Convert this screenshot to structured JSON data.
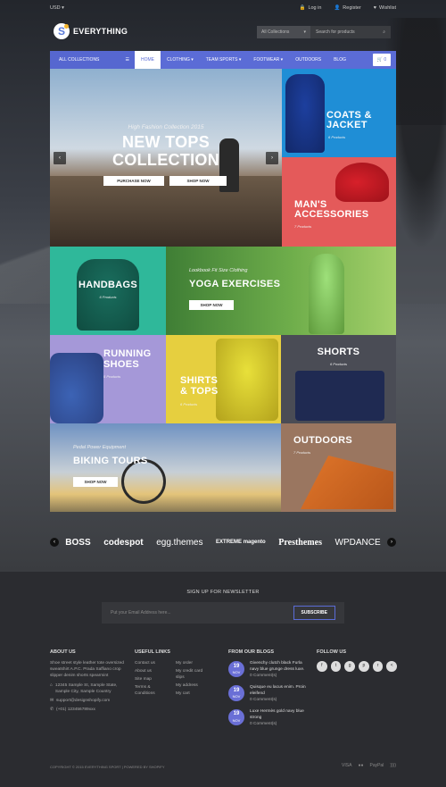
{
  "topbar": {
    "currency": "USD ▾",
    "login": "Log in",
    "register": "Register",
    "wishlist": "Wishlist"
  },
  "brand": {
    "name": "EVERYTHING",
    "mark": "S"
  },
  "search": {
    "category": "All Collections",
    "placeholder": "Search for products"
  },
  "nav": {
    "all": "ALL COLLECTIONS",
    "items": [
      "HOME",
      "CLOTHING ▾",
      "TEAM SPORTS ▾",
      "FOOTWEAR ▾",
      "OUTDOORS",
      "BLOG"
    ],
    "cart": "0"
  },
  "slider": {
    "kicker": "High Fashion Collection 2015",
    "title1": "NEW TOPS",
    "title2": "COLLECTION",
    "btn1": "PURCHASE NOW",
    "btn2": "SHOP NOW"
  },
  "tiles": {
    "coats": {
      "t1": "COATS &",
      "t2": "JACKET",
      "sub": "6 Products"
    },
    "mans": {
      "t1": "MAN'S",
      "t2": "ACCESSORIES",
      "sub": "7 Products"
    },
    "handbags": {
      "t1": "HANDBAGS",
      "sub": "6 Products"
    },
    "yoga": {
      "kicker": "Lookbook Fit Size Clothing",
      "t1": "YOGA EXERCISES",
      "btn": "SHOP NOW"
    },
    "running": {
      "t1": "RUNNING",
      "t2": "SHOES",
      "sub": "5 Products"
    },
    "shirts": {
      "t1": "SHIRTS",
      "t2": "& TOPS",
      "sub": "6 Products"
    },
    "shorts": {
      "t1": "SHORTS",
      "sub": "6 Products"
    },
    "biking": {
      "kicker": "Pedal Power Equipment",
      "t1": "BIKING TOURS",
      "btn": "SHOP NOW"
    },
    "outdoors": {
      "t1": "OUTDOORS",
      "sub": "7 Products"
    }
  },
  "partners": [
    "BOSS",
    "codespot",
    "egg.themes",
    "EXTREME magento",
    "Presthemes",
    "WPDANCE"
  ],
  "newsletter": {
    "heading": "SIGN UP FOR NEWSLETTER",
    "placeholder": "Put your Email Address here...",
    "button": "SUBSCRIBE"
  },
  "about": {
    "heading": "ABOUT US",
    "text": "Shoe street style leather tote oversized sweatshirt A.P.C. Prada Saffiano crop slipper denim shorts spearmint",
    "address": "12345 Sample St, Sample State, Sample City, Sample Country",
    "email": "support@designshopify.com",
    "phone": "(+01) 123456789xxx"
  },
  "useful": {
    "heading": "USEFUL LINKS",
    "col1": [
      "Contact us",
      "About us",
      "Site map",
      "Terms & Conditions"
    ],
    "col2": [
      "My order",
      "My credit card slips",
      "My address",
      "My cart"
    ]
  },
  "blogs": {
    "heading": "FROM OUR BLOGS",
    "items": [
      {
        "day": "19",
        "mon": "NOV",
        "title": "Givenchy clutch black Furla navy blue grunge dress luxe.",
        "comments": "0 Comment(s)"
      },
      {
        "day": "19",
        "mon": "NOV",
        "title": "Quisque eu lacus enim. Proin eleifend",
        "comments": "0 Comment(s)"
      },
      {
        "day": "19",
        "mon": "NOV",
        "title": "Luxe Hermès gold navy blue strong",
        "comments": "0 Comment(s)"
      }
    ]
  },
  "follow": {
    "heading": "FOLLOW US"
  },
  "copyright": "COPYRIGHT © 2015 EVERYTHING SPORT | POWERED BY SHOPIFY",
  "payments": [
    "VISA",
    "●●",
    "PayPal",
    "))))"
  ]
}
